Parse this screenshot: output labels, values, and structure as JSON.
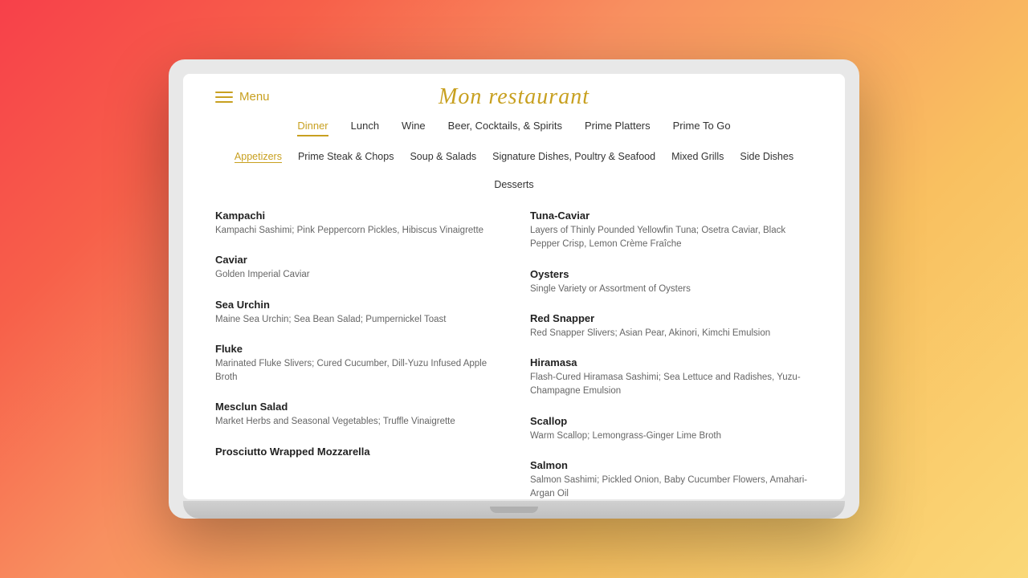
{
  "header": {
    "menu_label": "Menu",
    "restaurant_name": "Mon restaurant"
  },
  "nav": {
    "tabs": [
      {
        "label": "Dinner",
        "active": true
      },
      {
        "label": "Lunch",
        "active": false
      },
      {
        "label": "Wine",
        "active": false
      },
      {
        "label": "Beer, Cocktails, & Spirits",
        "active": false
      },
      {
        "label": "Prime Platters",
        "active": false
      },
      {
        "label": "Prime To Go",
        "active": false
      }
    ],
    "sub_tabs": [
      {
        "label": "Appetizers",
        "active": true
      },
      {
        "label": "Prime Steak & Chops",
        "active": false
      },
      {
        "label": "Soup & Salads",
        "active": false
      },
      {
        "label": "Signature Dishes, Poultry & Seafood",
        "active": false
      },
      {
        "label": "Mixed Grills",
        "active": false
      },
      {
        "label": "Side Dishes",
        "active": false
      },
      {
        "label": "Desserts",
        "active": false
      }
    ]
  },
  "menu_items": {
    "left": [
      {
        "name": "Kampachi",
        "desc": "Kampachi Sashimi; Pink Peppercorn Pickles, Hibiscus Vinaigrette"
      },
      {
        "name": "Caviar",
        "desc": "Golden Imperial Caviar"
      },
      {
        "name": "Sea Urchin",
        "desc": "Maine Sea Urchin; Sea Bean Salad; Pumpernickel Toast"
      },
      {
        "name": "Fluke",
        "desc": "Marinated Fluke Slivers; Cured Cucumber, Dill-Yuzu Infused Apple Broth"
      },
      {
        "name": "Mesclun Salad",
        "desc": "Market Herbs and Seasonal Vegetables; Truffle Vinaigrette"
      },
      {
        "name": "Prosciutto Wrapped Mozzarella",
        "desc": ""
      }
    ],
    "right": [
      {
        "name": "Tuna-Caviar",
        "desc": "Layers of Thinly Pounded Yellowfin Tuna; Osetra Caviar, Black Pepper Crisp, Lemon Crème Fraîche"
      },
      {
        "name": "Oysters",
        "desc": "Single Variety or Assortment of Oysters"
      },
      {
        "name": "Red Snapper",
        "desc": "Red Snapper Slivers; Asian Pear, Akinori, Kimchi Emulsion"
      },
      {
        "name": "Hiramasa",
        "desc": "Flash-Cured Hiramasa Sashimi; Sea Lettuce and Radishes, Yuzu-Champagne Emulsion"
      },
      {
        "name": "Scallop",
        "desc": "Warm Scallop; Lemongrass-Ginger Lime Broth"
      },
      {
        "name": "Salmon",
        "desc": "Salmon Sashimi; Pickled Onion, Baby Cucumber Flowers, Amahari-Argan Oil"
      }
    ]
  }
}
